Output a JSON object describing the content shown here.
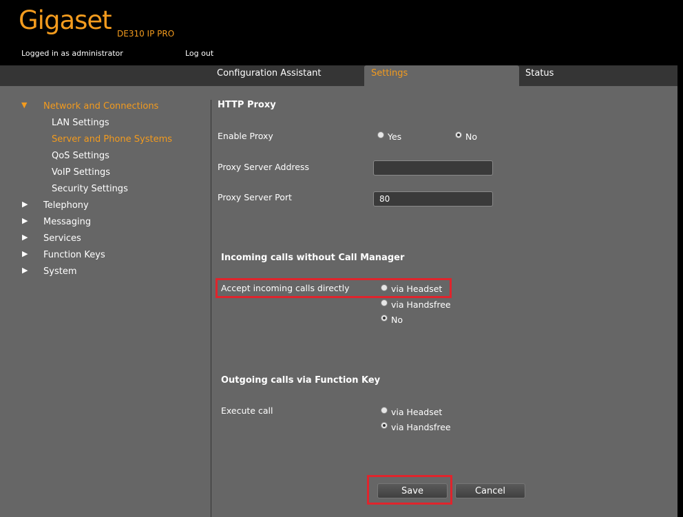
{
  "header": {
    "brand": "Gigaset",
    "model": "DE310 IP PRO",
    "login_status": "Logged in as administrator",
    "logout_label": "Log out"
  },
  "tabs": [
    {
      "label": "Configuration Assistant",
      "active": false
    },
    {
      "label": "Settings",
      "active": true
    },
    {
      "label": "Status",
      "active": false
    }
  ],
  "sidebar": {
    "items": [
      {
        "label": "Network and Connections",
        "expanded": true,
        "active": true
      },
      {
        "label": "LAN Settings"
      },
      {
        "label": "Server and Phone Systems",
        "active": true
      },
      {
        "label": "QoS Settings"
      },
      {
        "label": "VoIP Settings"
      },
      {
        "label": "Security Settings"
      },
      {
        "label": "Telephony",
        "expanded": false
      },
      {
        "label": "Messaging",
        "expanded": false
      },
      {
        "label": "Services",
        "expanded": false
      },
      {
        "label": "Function Keys",
        "expanded": false
      },
      {
        "label": "System",
        "expanded": false
      }
    ]
  },
  "http_proxy": {
    "title": "HTTP Proxy",
    "enable_label": "Enable Proxy",
    "yes_label": "Yes",
    "no_label": "No",
    "selected": "No",
    "address_label": "Proxy Server Address",
    "address_value": "",
    "port_label": "Proxy Server Port",
    "port_value": "80"
  },
  "incoming": {
    "title": "Incoming calls without Call Manager",
    "accept_label": "Accept incoming calls directly",
    "options": [
      "via Headset",
      "via Handsfree",
      "No"
    ],
    "selected": "No"
  },
  "outgoing": {
    "title": "Outgoing calls via Function Key",
    "execute_label": "Execute call",
    "options": [
      "via Headset",
      "via Handsfree"
    ],
    "selected": "via Handsfree"
  },
  "buttons": {
    "save": "Save",
    "cancel": "Cancel"
  },
  "colors": {
    "accent": "#f39b1e",
    "highlight": "#e0242c",
    "panel": "#666666"
  }
}
